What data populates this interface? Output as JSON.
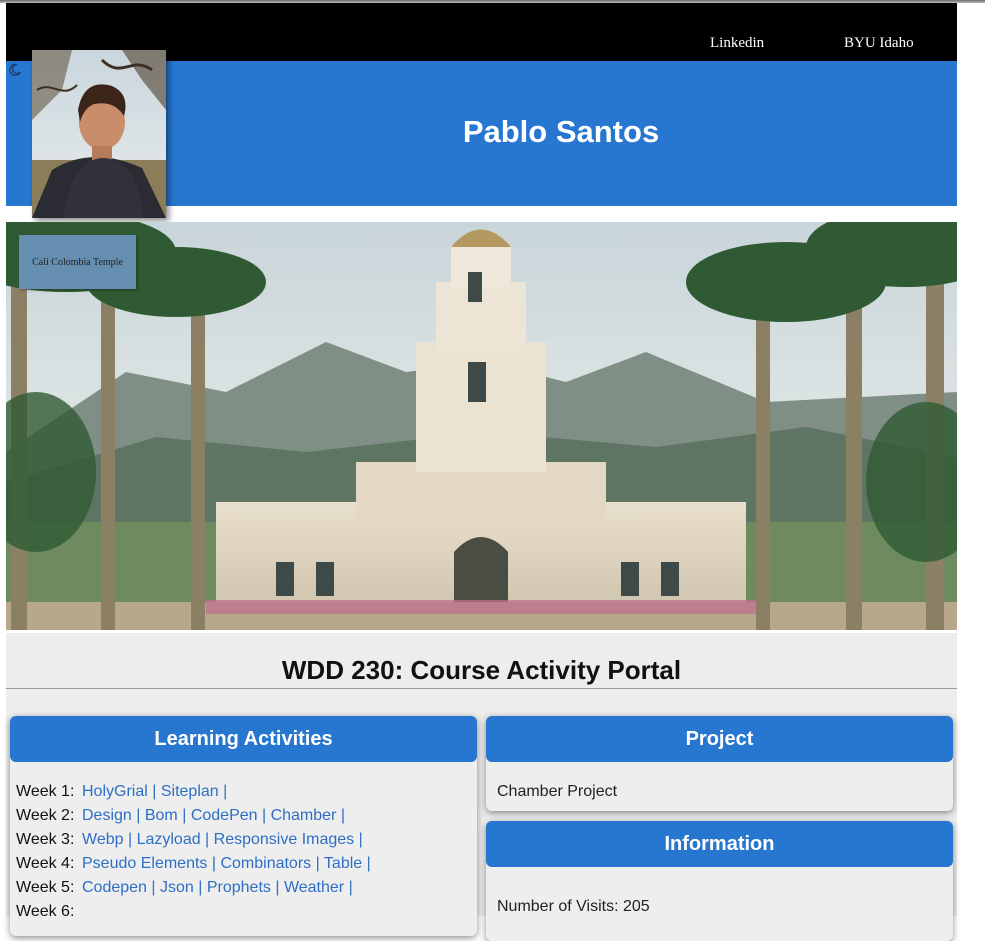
{
  "nav": {
    "links": [
      "Linkedin",
      "BYU Idaho"
    ]
  },
  "header": {
    "name": "Pablo Santos"
  },
  "hero": {
    "caption": "Cali Colombia Temple"
  },
  "main": {
    "title": "WDD 230: Course Activity Portal"
  },
  "learning": {
    "heading": "Learning Activities",
    "weeks": [
      {
        "label": "Week 1:",
        "links": [
          "HolyGrial",
          "Siteplan"
        ]
      },
      {
        "label": "Week 2:",
        "links": [
          "Design",
          "Bom",
          "CodePen",
          "Chamber"
        ]
      },
      {
        "label": "Week 3:",
        "links": [
          "Webp",
          "Lazyload",
          "Responsive Images"
        ]
      },
      {
        "label": "Week 4:",
        "links": [
          "Pseudo Elements",
          "Combinators",
          "Table"
        ]
      },
      {
        "label": "Week 5:",
        "links": [
          "Codepen",
          "Json",
          "Prophets",
          "Weather"
        ]
      },
      {
        "label": "Week 6:",
        "links": []
      }
    ]
  },
  "project": {
    "heading": "Project",
    "item": "Chamber Project"
  },
  "information": {
    "heading": "Information",
    "visits": "Number of Visits: 205"
  },
  "colors": {
    "brand_blue": "#2777d1",
    "nav_black": "#000000",
    "link_blue": "#2e6fc4",
    "panel_gray": "#ededed"
  }
}
